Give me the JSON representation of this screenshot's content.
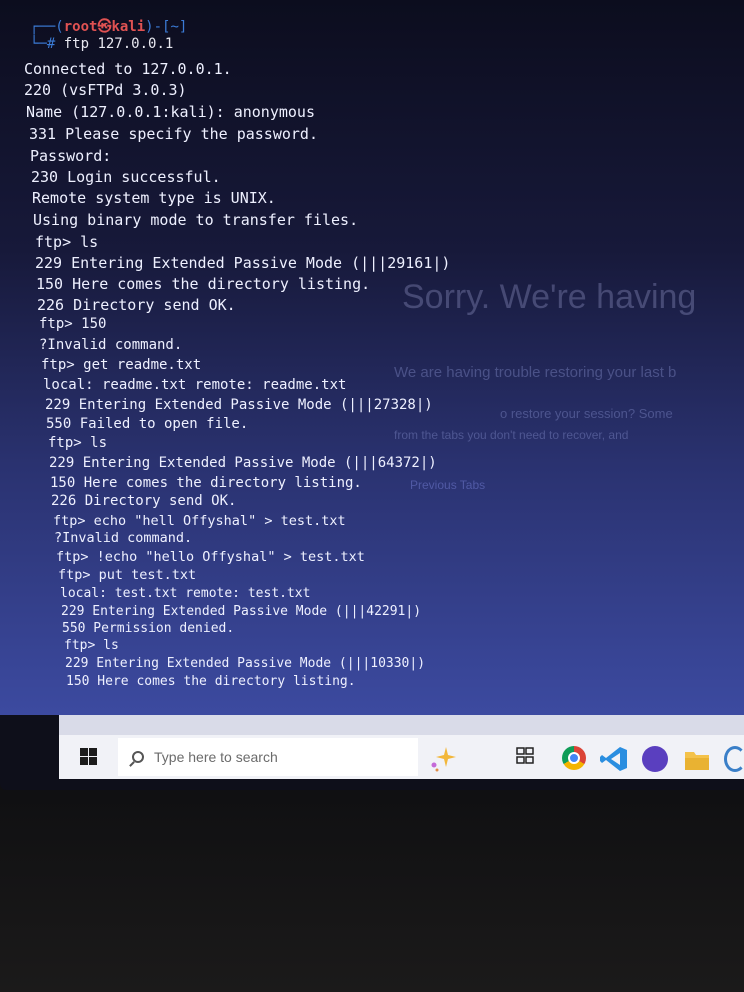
{
  "prompt": {
    "bracket_open": "┌──(",
    "user": "root",
    "at": "㉿",
    "host": "kali",
    "dir_part": ")-[~]",
    "hash": "└─#",
    "command": "ftp 127.0.0.1"
  },
  "terminal_lines": [
    "Connected to 127.0.0.1.",
    "220 (vsFTPd 3.0.3)",
    "Name (127.0.0.1:kali): anonymous",
    "331 Please specify the password.",
    "Password:",
    "230 Login successful.",
    "Remote system type is UNIX.",
    "Using binary mode to transfer files.",
    "ftp> ls",
    "229 Entering Extended Passive Mode (|||29161|)",
    "150 Here comes the directory listing.",
    "226 Directory send OK.",
    "ftp> 150",
    "?Invalid command.",
    "ftp> get readme.txt",
    "local: readme.txt remote: readme.txt",
    "229 Entering Extended Passive Mode (|||27328|)",
    "550 Failed to open file.",
    "ftp> ls",
    "229 Entering Extended Passive Mode (|||64372|)",
    "150 Here comes the directory listing.",
    "226 Directory send OK.",
    "ftp> echo \"hell Offyshal\" > test.txt",
    "?Invalid command.",
    "ftp> !echo \"hello Offyshal\" > test.txt",
    "ftp> put test.txt",
    "local: test.txt remote: test.txt",
    "229 Entering Extended Passive Mode (|||42291|)",
    "550 Permission denied.",
    "ftp> ls",
    "229 Entering Extended Passive Mode (|||10330|)",
    "150 Here comes the directory listing."
  ],
  "ghost_text": {
    "big": "Sorry. We're having",
    "line1": "We are having trouble restoring your last b",
    "line2": "o restore your session? Some",
    "line3": "from the tabs you don't need to recover, and",
    "line4": "Previous Tabs"
  },
  "taskbar": {
    "search_placeholder": "Type here to search",
    "icons": [
      "windows-start-icon",
      "search-icon",
      "sparkle-icon",
      "task-view-icon",
      "chrome-icon",
      "vscode-icon",
      "app-icon",
      "folder-icon",
      "edge-icon"
    ]
  }
}
